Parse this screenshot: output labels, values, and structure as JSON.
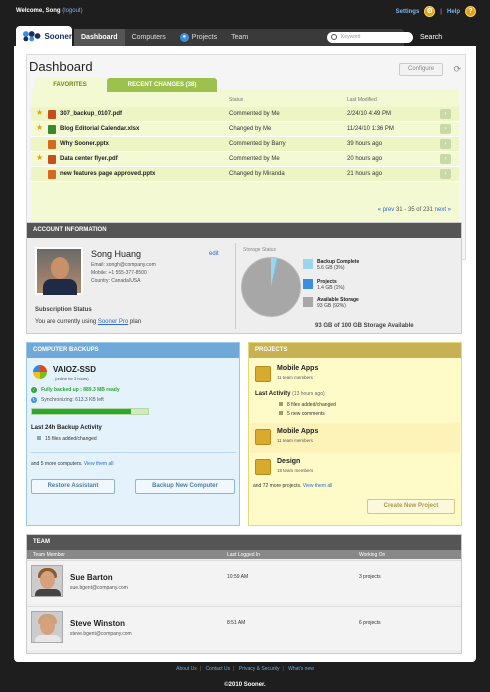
{
  "header": {
    "welcome": "Welcome, Song",
    "logout": "(logout)",
    "settings": "Settings",
    "help": "Help",
    "separator": "|"
  },
  "nav": {
    "logo_text": "Sooner",
    "tabs": [
      "Dashboard",
      "Computers",
      "Projects",
      "Team"
    ],
    "search_placeholder": "Keyword",
    "search_button": "Search"
  },
  "dashboard": {
    "title": "Dashboard",
    "configure": "Configure",
    "tab_favorites": "FAVORITES",
    "tab_recent": "RECENT CHANGES (38)",
    "col_status": "Status",
    "col_modified": "Last Modified",
    "rows": [
      {
        "name": "307_backup_0107.pdf",
        "status": "Commented by Me",
        "date": "2/24/10 4:49 PM"
      },
      {
        "name": "Blog Editorial Calendar.xlsx",
        "status": "Changed by Me",
        "date": "11/24/10 1:36 PM"
      },
      {
        "name": "Why Sooner.pptx",
        "status": "Commented by Barry",
        "date": "39 hours ago"
      },
      {
        "name": "Data center flyer.pdf",
        "status": "Commented by Me",
        "date": "20 hours ago"
      },
      {
        "name": "new features page approved.pptx",
        "status": "Changed by Miranda",
        "date": "21 hours ago"
      }
    ],
    "pager_prev": "« prev",
    "pager_range": "31 - 35 of 231",
    "pager_next": "next »"
  },
  "account": {
    "heading": "ACCOUNT INFORMATION",
    "name": "Song Huang",
    "email": "Email: songh@company.com",
    "mobile": "Mobile: +1 555-377-8500",
    "country": "Country: Canada/USA",
    "edit": "edit",
    "subscription_title": "Subscription Status",
    "subscription_text": "You are currently using",
    "plan": "Sooner Pro",
    "plan_suffix": "plan",
    "storage_title": "Storage Status",
    "legend": [
      {
        "label": "Backup Complete",
        "detail": "5.6 GB (3%)",
        "color": "#9dd6ec"
      },
      {
        "label": "Projects",
        "detail": "1.4 GB (1%)",
        "color": "#3c8de0"
      },
      {
        "label": "Available Storage",
        "detail": "93 GB (92%)",
        "color": "#a7a7a7"
      }
    ],
    "storage_total": "93 GB of 100 GB Storage Available",
    "pie_fractions": {
      "backup": 0.031,
      "projects": 0.01,
      "available": 0.959
    }
  },
  "backups": {
    "heading": "COMPUTER BACKUPS",
    "computer": "VAIOZ-SSD",
    "online": "(online for 3 hours)",
    "backed_up": "Fully backed up : 889.3 MB ready",
    "syncing": "Synchronizing: 613.3 KB left",
    "progress": 0.85,
    "last24": "Last 24h Backup Activity",
    "activity": "15 files added/changed",
    "more": "and 5 more computers.",
    "more_link": "View them all",
    "restore_button": "Restore Assistant",
    "backup_button": "Backup New Computer"
  },
  "projects": {
    "heading": "PROJECTS",
    "items": [
      {
        "name": "Mobile Apps",
        "members": "11 team members"
      },
      {
        "name": "Mobile Apps",
        "members": "11 team members"
      },
      {
        "name": "Design",
        "members": "18 team members"
      }
    ],
    "last_activity": "Last Activity",
    "last_activity_time": "(13 hours ago)",
    "activity_items": [
      "8 files added/changed",
      "5 new comments"
    ],
    "more": "and 72 more projects.",
    "more_link": "View them all",
    "create_button": "Create New Project"
  },
  "team": {
    "heading": "TEAM",
    "col_member": "Team Member",
    "col_logged": "Last Logged In",
    "col_working": "Working On",
    "members": [
      {
        "name": "Sue Barton",
        "email": "sue.bgent@company.com",
        "logged": "10:59 AM",
        "working": "3 projects"
      },
      {
        "name": "Steve Winston",
        "email": "steve.bgent@company.com",
        "logged": "8:51 AM",
        "working": "6 projects"
      }
    ]
  },
  "footer": {
    "links": [
      "About Us",
      "Contact Us",
      "Privacy & Security",
      "What's new"
    ],
    "copyright": "©2010 Sooner."
  }
}
